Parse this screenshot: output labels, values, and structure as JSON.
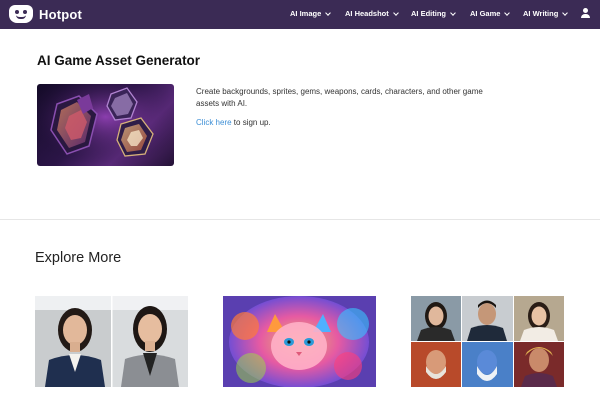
{
  "nav": {
    "brand": "Hotpot",
    "items": [
      {
        "label": "AI Image"
      },
      {
        "label": "AI Headshot"
      },
      {
        "label": "AI Editing"
      },
      {
        "label": "AI Game"
      },
      {
        "label": "AI Writing"
      }
    ]
  },
  "hero": {
    "title": "AI Game Asset Generator",
    "description": "Create backgrounds, sprites, gems, weapons, cards, characters, and other game assets with AI.",
    "cta_link": "Click here",
    "cta_suffix": " to sign up."
  },
  "explore": {
    "title": "Explore More"
  },
  "colors": {
    "nav_bg": "#3b2b55",
    "link": "#3d8fd6"
  }
}
